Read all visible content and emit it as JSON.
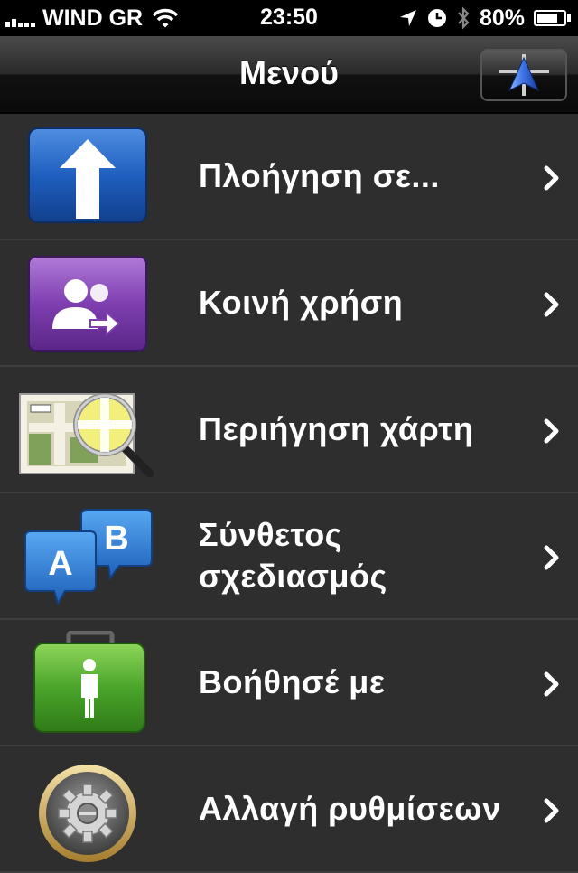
{
  "status_bar": {
    "carrier": "WIND GR",
    "time": "23:50",
    "battery": "80%",
    "battery_level": 0.8
  },
  "nav": {
    "title": "Μενού",
    "nav_button_icon": "navigation-arrow-icon"
  },
  "menu": {
    "items": [
      {
        "label": "Πλοήγηση σε...",
        "icon": "up-arrow-sign-icon"
      },
      {
        "label": "Κοινή χρήση",
        "icon": "share-people-icon"
      },
      {
        "label": "Περιήγηση χάρτη",
        "icon": "map-magnifier-icon"
      },
      {
        "label": "Σύνθετος σχεδιασμός",
        "icon": "route-a-b-icon"
      },
      {
        "label": "Βοήθησέ με",
        "icon": "first-aid-kit-icon"
      },
      {
        "label": "Αλλαγή ρυθμίσεων",
        "icon": "settings-gear-icon"
      }
    ]
  }
}
